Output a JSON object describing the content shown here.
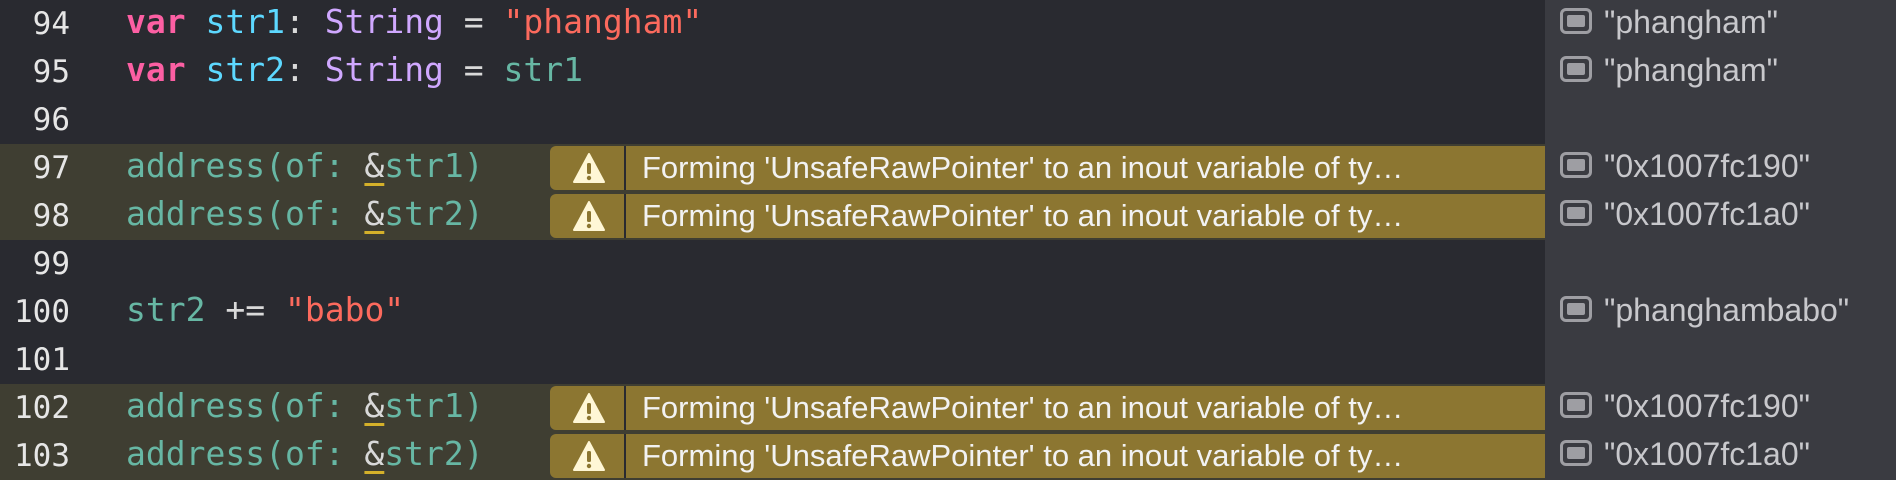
{
  "lines": [
    {
      "num": "94"
    },
    {
      "num": "95"
    },
    {
      "num": "96"
    },
    {
      "num": "97"
    },
    {
      "num": "98"
    },
    {
      "num": "99"
    },
    {
      "num": "100"
    },
    {
      "num": "101"
    },
    {
      "num": "102"
    },
    {
      "num": "103"
    }
  ],
  "code": {
    "l94": {
      "kw": "var",
      "name": "str1",
      "colon": ": ",
      "type": "String",
      "eq": " = ",
      "value": "\"phangham\""
    },
    "l95": {
      "kw": "var",
      "name": "str2",
      "colon": ": ",
      "type": "String",
      "eq": " = ",
      "value": "str1"
    },
    "l97": {
      "fn": "address(of: ",
      "amp": "&",
      "arg": "str1",
      "close": ")"
    },
    "l98": {
      "fn": "address(of: ",
      "amp": "&",
      "arg": "str2",
      "close": ")"
    },
    "l100": {
      "name": "str2",
      "op": " += ",
      "value": "\"babo\""
    },
    "l102": {
      "fn": "address(of: ",
      "amp": "&",
      "arg": "str1",
      "close": ")"
    },
    "l103": {
      "fn": "address(of: ",
      "amp": "&",
      "arg": "str2",
      "close": ")"
    }
  },
  "warning": {
    "message": "Forming 'UnsafeRawPointer' to an inout variable of ty…",
    "icon": "warning-triangle-icon",
    "color": "#8c7631"
  },
  "results": {
    "r94": "\"phangham\"",
    "r95": "\"phangham\"",
    "r97": "\"0x1007fc190\"",
    "r98": "\"0x1007fc1a0\"",
    "r100": "\"phanghambabo\"",
    "r102": "\"0x1007fc190\"",
    "r103": "\"0x1007fc1a0\""
  }
}
